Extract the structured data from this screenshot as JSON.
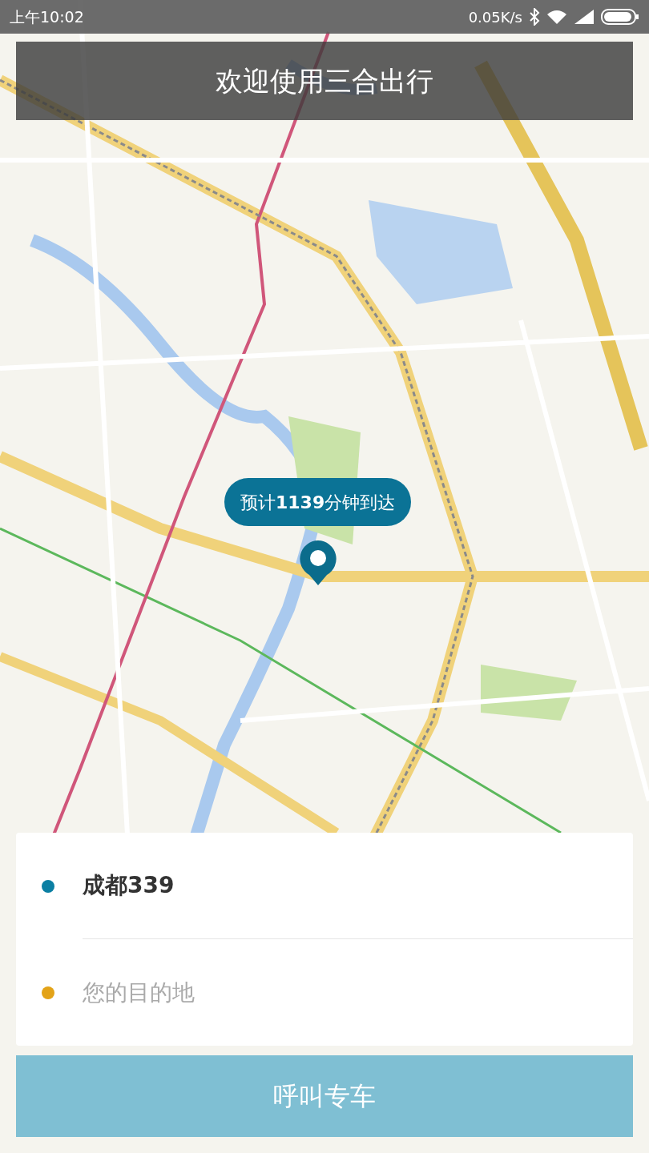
{
  "status_bar": {
    "time": "上午10:02",
    "speed": "0.05K/s"
  },
  "banner": {
    "title": "欢迎使用三合出行"
  },
  "eta_bubble": {
    "text": "预计**1139**分钟到达"
  },
  "stops": [
    {
      "kind": "value",
      "text": "成都339",
      "color": "#0b7fa3"
    },
    {
      "kind": "placeholder",
      "placeholder": "您的目的地",
      "color": "#e3a318"
    }
  ],
  "call_button": {
    "label": "呼叫专车"
  }
}
